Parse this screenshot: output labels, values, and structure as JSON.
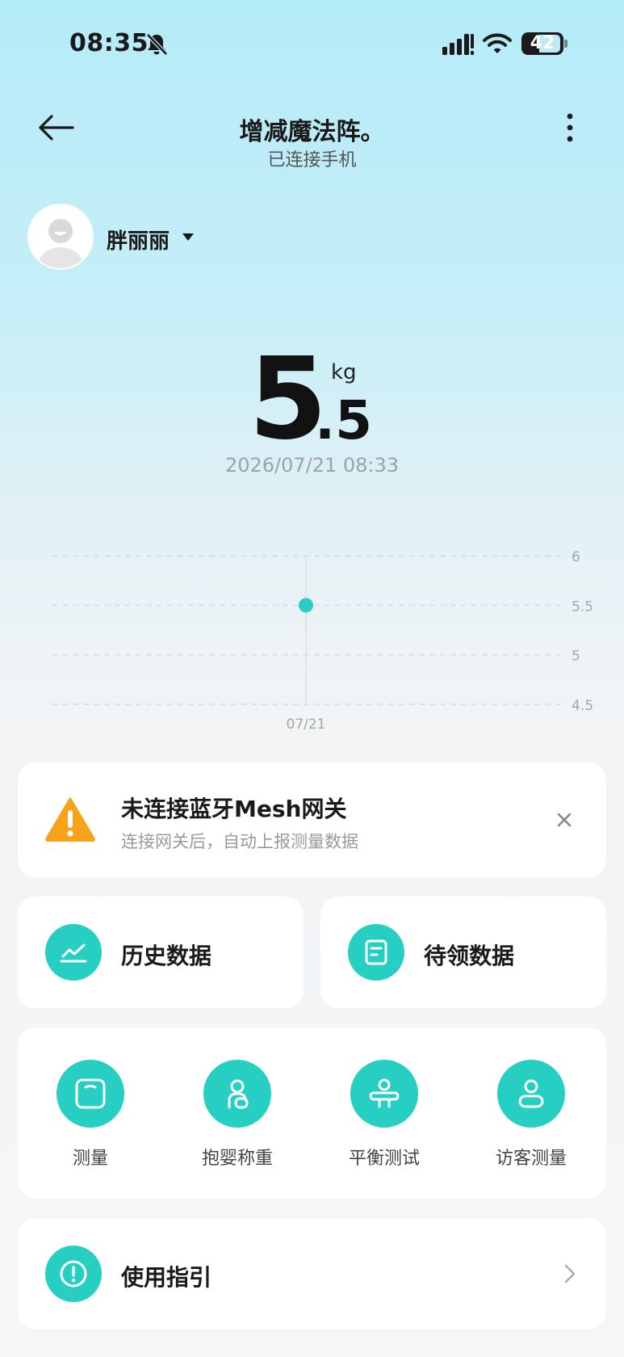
{
  "status_bar": {
    "time": "08:35",
    "battery": "42"
  },
  "header": {
    "title": "增减魔法阵。",
    "subtitle": "已连接手机"
  },
  "user": {
    "name": "胖丽丽"
  },
  "weight": {
    "integer": "5",
    "decimal": ".5",
    "unit": "kg",
    "timestamp": "2026/07/21 08:33"
  },
  "chart_data": {
    "type": "line",
    "x": [
      "07/21"
    ],
    "series": [
      {
        "values": [
          5.5
        ]
      }
    ],
    "y_ticks": [
      "6",
      "5.5",
      "5",
      "4.5"
    ],
    "ylim": [
      4.5,
      6
    ],
    "grid": true,
    "point_color": "#26cfc2"
  },
  "alert": {
    "title": "未连接蓝牙Mesh网关",
    "description": "连接网关后，自动上报测量数据"
  },
  "quick_cards": {
    "history_label": "历史数据",
    "pending_label": "待领数据"
  },
  "functions": [
    {
      "label": "测量",
      "icon": "scale-icon"
    },
    {
      "label": "抱婴称重",
      "icon": "baby-weigh-icon"
    },
    {
      "label": "平衡测试",
      "icon": "balance-icon"
    },
    {
      "label": "访客测量",
      "icon": "visitor-icon"
    }
  ],
  "guide": {
    "label": "使用指引"
  },
  "colors": {
    "accent": "#26cfc2",
    "warning": "#f7a21b",
    "bg_top": "#b4ebf8"
  }
}
